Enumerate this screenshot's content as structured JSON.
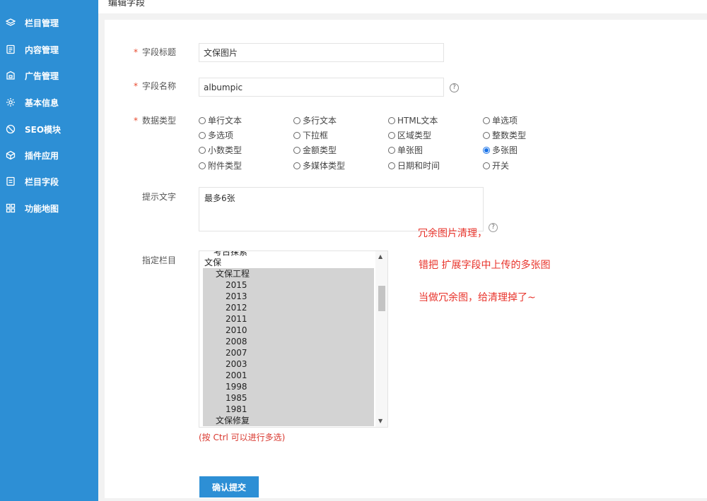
{
  "header": {
    "title": "编辑字段"
  },
  "sidebar": {
    "items": [
      {
        "label": "栏目管理",
        "icon": "layers-icon"
      },
      {
        "label": "内容管理",
        "icon": "document-icon"
      },
      {
        "label": "广告管理",
        "icon": "ad-icon"
      },
      {
        "label": "基本信息",
        "icon": "gear-icon"
      },
      {
        "label": "SEO模块",
        "icon": "seo-icon"
      },
      {
        "label": "插件应用",
        "icon": "cube-icon"
      },
      {
        "label": "栏目字段",
        "icon": "field-icon"
      },
      {
        "label": "功能地图",
        "icon": "grid-icon"
      }
    ]
  },
  "form": {
    "required_mark": "*",
    "field_title": {
      "label": "字段标题",
      "value": "文保图片"
    },
    "field_name": {
      "label": "字段名称",
      "value": "albumpic",
      "help": "?"
    },
    "data_type": {
      "label": "数据类型",
      "options": [
        "单行文本",
        "多行文本",
        "HTML文本",
        "单选项",
        "多选项",
        "下拉框",
        "区域类型",
        "整数类型",
        "小数类型",
        "金额类型",
        "单张图",
        "多张图",
        "附件类型",
        "多媒体类型",
        "日期和时间",
        "开关"
      ],
      "selected": "多张图"
    },
    "hint_text": {
      "label": "提示文字",
      "value": "最多6张"
    },
    "category": {
      "label": "指定栏目",
      "partial_top": "考古探索",
      "options": [
        {
          "text": "文保",
          "selected": false
        },
        {
          "text": "文保工程",
          "selected": true
        },
        {
          "text": "2015",
          "selected": true
        },
        {
          "text": "2013",
          "selected": true
        },
        {
          "text": "2012",
          "selected": true
        },
        {
          "text": "2011",
          "selected": true
        },
        {
          "text": "2010",
          "selected": true
        },
        {
          "text": "2008",
          "selected": true
        },
        {
          "text": "2007",
          "selected": true
        },
        {
          "text": "2003",
          "selected": true
        },
        {
          "text": "2001",
          "selected": true
        },
        {
          "text": "1998",
          "selected": true
        },
        {
          "text": "1985",
          "selected": true
        },
        {
          "text": "1981",
          "selected": true
        },
        {
          "text": "文保修复",
          "selected": true
        }
      ],
      "hint": "(按 Ctrl 可以进行多选)"
    },
    "submit_label": "确认提交"
  },
  "annotation": {
    "line1": "冗余图片清理，",
    "line2": "错把 扩展字段中上传的多张图",
    "line3": "当做冗余图，给清理掉了~",
    "help": "?"
  },
  "colors": {
    "sidebar": "#2d8fd5",
    "annotation": "#e8332b",
    "required": "#e84a2f"
  }
}
